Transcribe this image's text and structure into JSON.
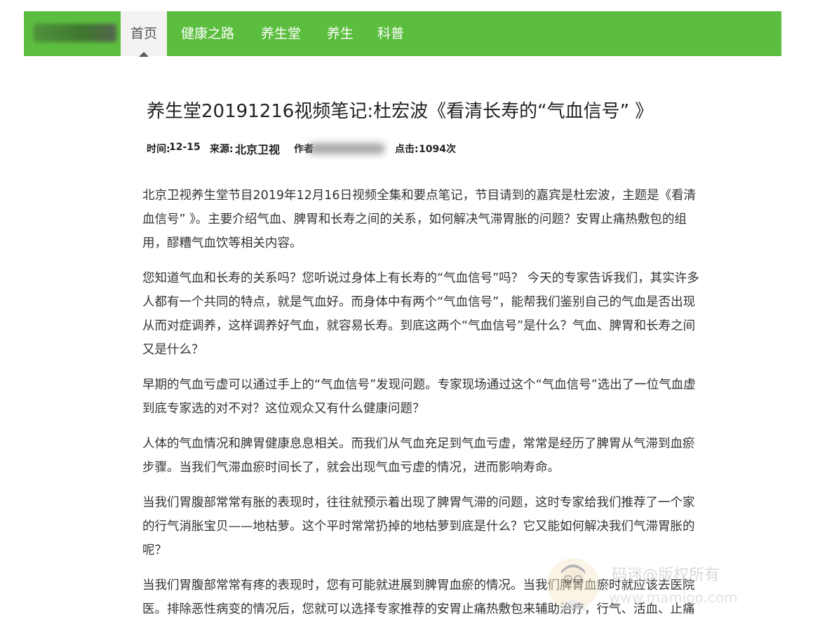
{
  "nav": {
    "logo_bracket": "]",
    "items": [
      {
        "label": "首页",
        "active": true
      },
      {
        "label": "健康之路"
      },
      {
        "label": "养生堂"
      },
      {
        "label": "养生"
      },
      {
        "label": "科普"
      }
    ]
  },
  "article": {
    "title": "养生堂20191216视频笔记:杜宏波《看清长寿的“气血信号” 》",
    "meta": {
      "time_label": "时间:",
      "time_value": "12-15",
      "source_label": "来源:",
      "source_value": "北京卫视",
      "author_label": "作者",
      "clicks_label": "点击:",
      "clicks_value": "1094次"
    },
    "paragraphs": [
      [
        "北京卫视养生堂节目2019年12月16日视频全集和要点笔记，节目请到的嘉宾是杜宏波，主题是《看清",
        "血信号” 》。主要介绍气血、脾胃和长寿之间的关系，如何解决气滞胃胀的问题？安胃止痛热敷包的组",
        "用，醪糟气血饮等相关内容。"
      ],
      [
        "您知道气血和长寿的关系吗？您听说过身体上有长寿的“气血信号”吗？ 今天的专家告诉我们，其实许多",
        "人都有一个共同的特点，就是气血好。而身体中有两个“气血信号”，能帮我们鉴别自己的气血是否出现",
        "从而对症调养，这样调养好气血，就容易长寿。到底这两个“气血信号”是什么？气血、脾胃和长寿之间",
        "又是什么？"
      ],
      [
        "早期的气血亏虚可以通过手上的“气血信号”发现问题。专家现场通过这个“气血信号”选出了一位气血虚",
        "到底专家选的对不对？这位观众又有什么健康问题？"
      ],
      [
        "人体的气血情况和脾胃健康息息相关。而我们从气血充足到气血亏虚，常常是经历了脾胃从气滞到血瘀",
        "步骤。当我们气滞血瘀时间长了，就会出现气血亏虚的情况，进而影响寿命。"
      ],
      [
        "当我们胃腹部常常有胀的表现时，往往就预示着出现了脾胃气滞的问题，这时专家给我们推荐了一个家",
        "的行气消胀宝贝——地枯萝。这个平时常常扔掉的地枯萝到底是什么？它又能如何解决我们气滞胃胀的",
        "呢？"
      ],
      [
        "当我们胃腹部常常有疼的表现时，您有可能就进展到脾胃血瘀的情况。当我们脾胃血瘀时就应该去医院",
        "医。排除恶性病变的情况后，您就可以选择专家推荐的安胃止痛热敷包来辅助治疗，行气、活血、止痛"
      ]
    ]
  },
  "watermark": {
    "line1": "码迷@版权所有",
    "line2": "www.mamioo.com"
  }
}
